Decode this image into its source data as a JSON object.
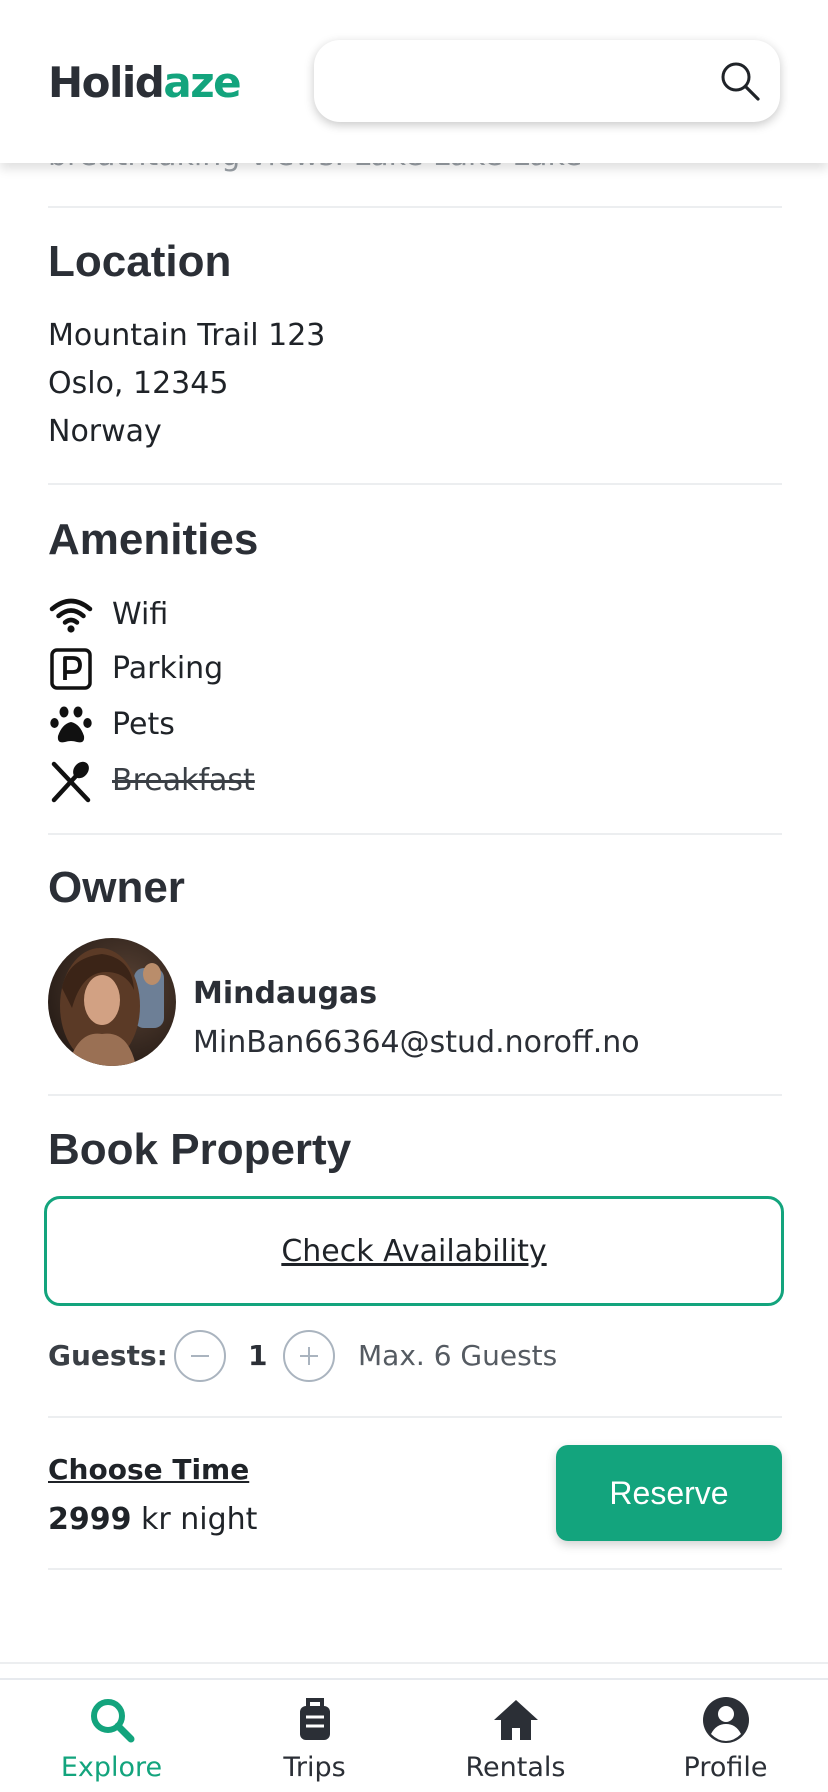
{
  "brand": {
    "part1": "Holid",
    "part2": "aze"
  },
  "search": {
    "placeholder": "",
    "value": ""
  },
  "cutoff_text": "breathtaking views. Lake Lake Lake",
  "location": {
    "heading": "Location",
    "address_line": "Mountain Trail 123",
    "city_line": "Oslo, 12345",
    "country_line": "Norway"
  },
  "amenities": {
    "heading": "Amenities",
    "items": [
      {
        "label": "Wifi",
        "icon": "wifi-icon",
        "available": true
      },
      {
        "label": "Parking",
        "icon": "parking-icon",
        "available": true
      },
      {
        "label": "Pets",
        "icon": "paw-icon",
        "available": true
      },
      {
        "label": "Breakfast",
        "icon": "utensils-icon",
        "available": false
      }
    ]
  },
  "owner": {
    "heading": "Owner",
    "name": "Mindaugas",
    "email": "MinBan66364@stud.noroff.no"
  },
  "booking": {
    "heading": "Book Property",
    "check_availability_label": "Check Availability",
    "guests_label": "Guests:",
    "guest_count": "1",
    "max_guests": "Max. 6 Guests",
    "choose_time_label": "Choose Time",
    "price_amount": "2999",
    "price_suffix": " kr night",
    "reserve_label": "Reserve"
  },
  "bottom_nav": {
    "items": [
      {
        "label": "Explore",
        "icon": "search-icon",
        "active": true
      },
      {
        "label": "Trips",
        "icon": "luggage-icon",
        "active": false
      },
      {
        "label": "Rentals",
        "icon": "home-icon",
        "active": false
      },
      {
        "label": "Profile",
        "icon": "user-circle-icon",
        "active": false
      }
    ]
  },
  "colors": {
    "accent": "#13a47d",
    "text_dark": "#2b2f36",
    "divider": "#eceef0"
  }
}
